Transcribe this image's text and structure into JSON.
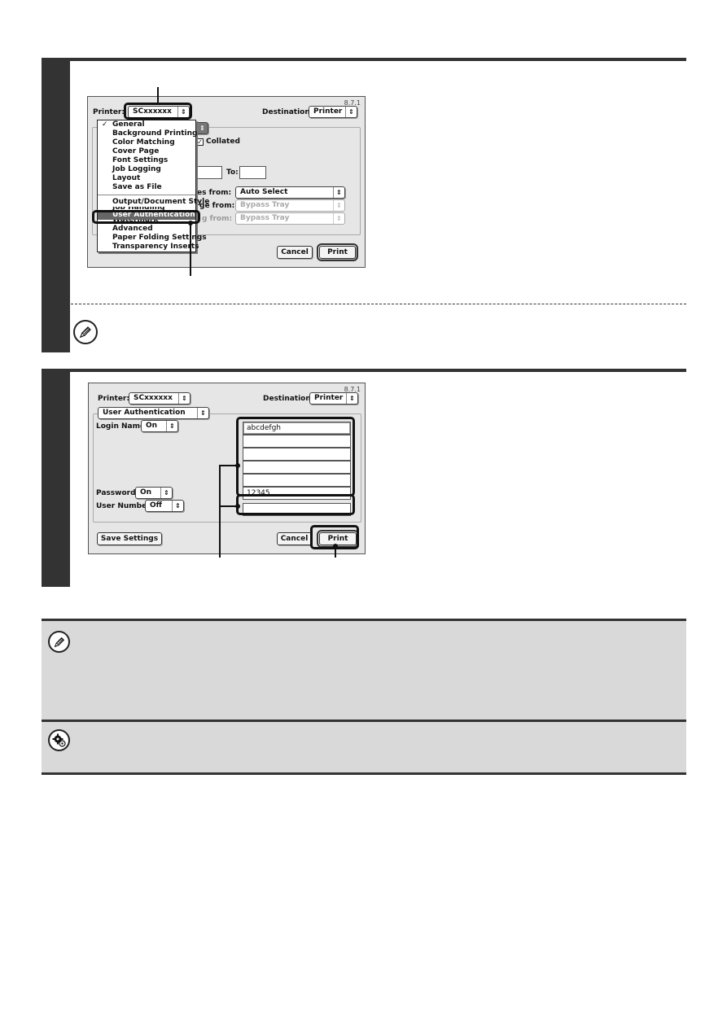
{
  "step1": {
    "dialog": {
      "version": "8.7.1",
      "printer_label": "Printer:",
      "printer_value": "SCxxxxxx",
      "destination_label": "Destination:",
      "destination_value": "Printer",
      "collated_label": "Collated",
      "collated_checked": true,
      "to_label": "To:",
      "paper_source_partial_1": "es from:",
      "paper_source_value_1": "Auto Select",
      "paper_source_partial_2": "ge from:",
      "paper_source_value_2": "Bypass Tray",
      "paper_source_partial_3": "g from:",
      "paper_source_value_3": "Bypass Tray",
      "cancel_label": "Cancel",
      "print_label": "Print"
    },
    "menu": {
      "items": [
        {
          "label": "General",
          "checked": true
        },
        {
          "label": "Background Printing"
        },
        {
          "label": "Color Matching"
        },
        {
          "label": "Cover Page"
        },
        {
          "label": "Font Settings"
        },
        {
          "label": "Job Logging"
        },
        {
          "label": "Layout"
        },
        {
          "label": "Save as File"
        },
        {
          "label": "Output/Document Style"
        },
        {
          "label": "Job Handling"
        },
        {
          "label": "User Authentication",
          "selected": true
        },
        {
          "label": "Watermark"
        },
        {
          "label": "Advanced"
        },
        {
          "label": "Paper Folding Settings"
        },
        {
          "label": "Transparency Inserts"
        }
      ],
      "check_glyph": "✓"
    }
  },
  "step2": {
    "dialog": {
      "version": "8.7.1",
      "printer_label": "Printer:",
      "printer_value": "SCxxxxxx",
      "destination_label": "Destination:",
      "destination_value": "Printer",
      "panel_value": "User Authentication",
      "login_name_label": "Login Name:",
      "login_name_value": "On",
      "password_label": "Password:",
      "password_value": "On",
      "user_number_label": "User Number:",
      "user_number_value": "Off",
      "fields": [
        "abcdefgh",
        "",
        "",
        "",
        "",
        "12345",
        ""
      ],
      "save_settings_label": "Save Settings",
      "cancel_label": "Cancel",
      "print_label": "Print"
    }
  },
  "icons": {
    "popup_arrow": "⇕",
    "checkbox_mark": "✓"
  },
  "colors": {
    "step_bar": "#333333",
    "note_background": "#d9d9d9",
    "dialog_background": "#e6e6e6",
    "menu_highlight": "#666666"
  }
}
